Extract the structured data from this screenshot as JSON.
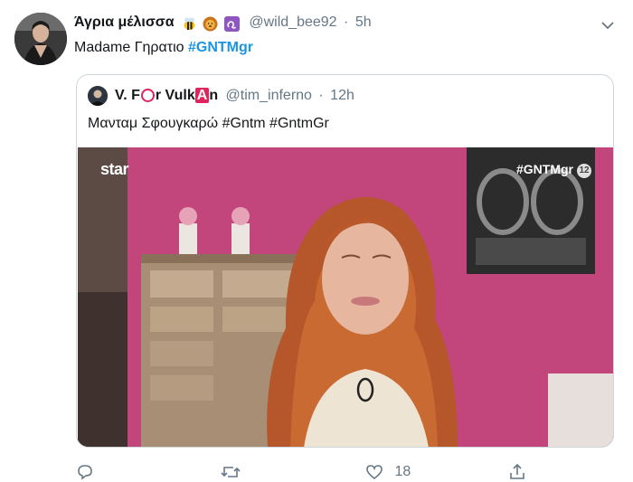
{
  "tweet": {
    "display_name": "Άγρια μέλισσα",
    "emoji_icons": [
      "bee-emoji",
      "lion-emoji",
      "leo-sign-emoji"
    ],
    "handle": "@wild_bee92",
    "separator": "·",
    "time": "5h",
    "text_prefix": "Madame Γηρατιο ",
    "hashtag": "#GNTMgr",
    "actions": {
      "like_count": "18"
    }
  },
  "quoted_tweet": {
    "name_parts": {
      "a": "V. F",
      "b": "r Vulk",
      "c": "A",
      "d": "n"
    },
    "handle": "@tim_inferno",
    "separator": "·",
    "time": "12h",
    "text": "Μανταμ Σφουγκαρώ #Gntm #GntmGr"
  },
  "media": {
    "channel_logo": "star",
    "hashtag_overlay": "#GNTMgr",
    "rating_badge": "12"
  },
  "colors": {
    "accent": "#1b95e0",
    "muted": "#657786",
    "border": "#ccd6dd",
    "wall_pink": "#c2457c"
  }
}
